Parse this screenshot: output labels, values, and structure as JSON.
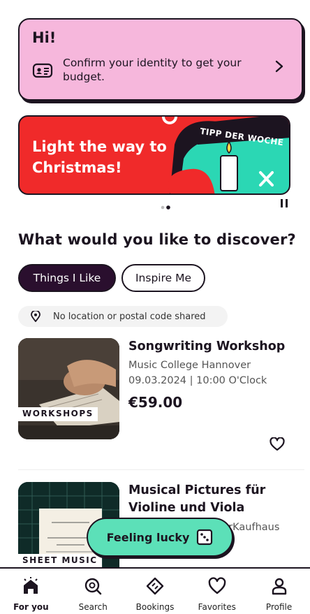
{
  "hint": {
    "title": "Hi!",
    "text": "Confirm your identity to get your budget."
  },
  "banner": {
    "title": "Light the way to Christmas!",
    "tag": "TIPP DER WOCHE",
    "page_count": 2,
    "active_page": 2
  },
  "discover": {
    "title": "What would you like to discover?",
    "chips": [
      "Things I Like",
      "Inspire Me"
    ],
    "active_chip": 0
  },
  "location": {
    "text": "No location or postal code shared"
  },
  "events": [
    {
      "title": "Songwriting Workshop",
      "venue": "Music College Hannover",
      "date": "09.03.2024 | 10:00 O'Clock",
      "price": "€59.00",
      "category": "WORKSHOPS"
    },
    {
      "title": "Musical Pictures für Violine und Viola",
      "venue": "urKaufhaus",
      "category": "SHEET MUSIC"
    }
  ],
  "lucky": {
    "label": "Feeling lucky"
  },
  "tabs": [
    {
      "label": "For you",
      "icon": "home-icon"
    },
    {
      "label": "Search",
      "icon": "search-icon"
    },
    {
      "label": "Bookings",
      "icon": "ticket-icon"
    },
    {
      "label": "Favorites",
      "icon": "heart-icon"
    },
    {
      "label": "Profile",
      "icon": "person-icon"
    }
  ],
  "colors": {
    "pink": "#f6b7dc",
    "red": "#f02a2a",
    "teal": "#5ce0b8",
    "ink": "#1c1420",
    "chip_active": "#2a0f2e"
  }
}
